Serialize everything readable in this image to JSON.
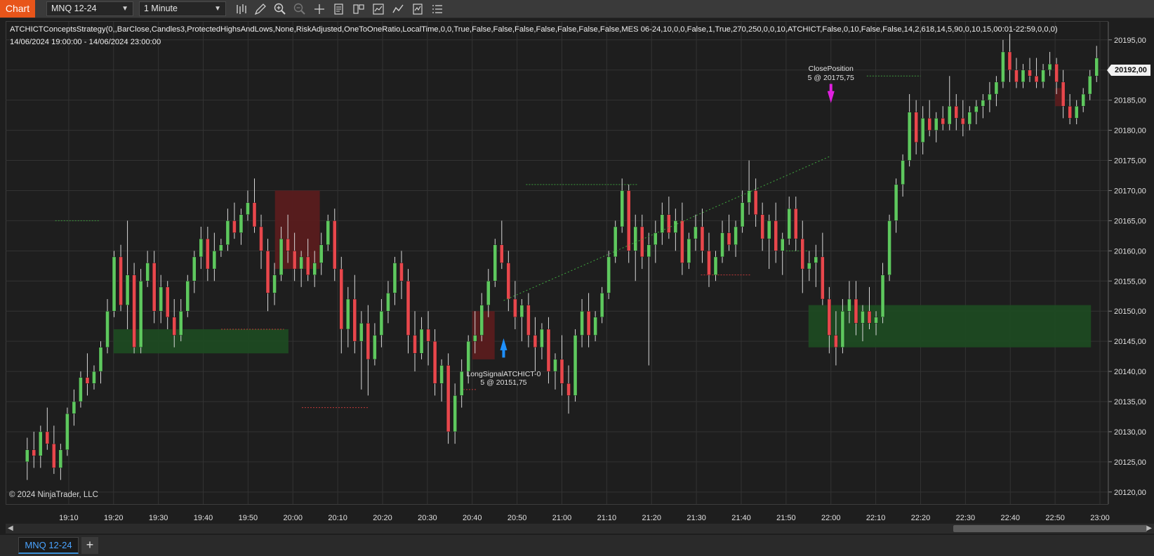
{
  "toolbar": {
    "chart_tab": "Chart",
    "instrument": "MNQ 12-24",
    "interval": "1 Minute",
    "icons": [
      "bar-type-icon",
      "draw-pencil-icon",
      "zoom-in-icon",
      "zoom-out-icon",
      "crosshair-icon",
      "properties-icon",
      "templates-icon",
      "chart-trader-icon",
      "indicators-icon",
      "strategies-icon",
      "data-box-icon"
    ]
  },
  "header": {
    "strategy_params": "ATCHICTConceptsStrategy(0,,BarClose,Candles3,ProtectedHighsAndLows,None,RiskAdjusted,OneToOneRatio,LocalTime,0,0,True,False,False,False,False,False,False,False,MES 06-24,10,0,0,False,1,True,270,250,0,0,10,ATCHICT,False,0,10,False,False,14,2,618,14,5,90,0,10,15,00:01-22:59,0,0,0)",
    "date_range": "14/06/2024 19:00:00 - 14/06/2024 23:00:00"
  },
  "copyright": "© 2024 NinjaTrader, LLC",
  "price_axis": {
    "ticks": [
      "20195,00",
      "20190,00",
      "20185,00",
      "20180,00",
      "20175,00",
      "20170,00",
      "20165,00",
      "20160,00",
      "20155,00",
      "20150,00",
      "20145,00",
      "20140,00",
      "20135,00",
      "20130,00",
      "20125,00",
      "20120,00"
    ],
    "last_price": "20192,00"
  },
  "time_axis": {
    "ticks": [
      "19:10",
      "19:20",
      "19:30",
      "19:40",
      "19:50",
      "20:00",
      "20:10",
      "20:20",
      "20:30",
      "20:40",
      "20:50",
      "21:00",
      "21:10",
      "21:20",
      "21:30",
      "21:40",
      "21:50",
      "22:00",
      "22:10",
      "22:20",
      "22:30",
      "22:40",
      "22:50",
      "23:00"
    ]
  },
  "annotations": {
    "entry_label": "LongSignalATCHICT-0",
    "entry_fill": "5 @ 20151,75",
    "exit_label": "ClosePosition",
    "exit_fill": "5 @ 20175,75"
  },
  "colors": {
    "up_candle": "#5ec85e",
    "down_candle": "#e8474c",
    "demand_zone": "#1e4a22",
    "supply_zone": "#5a1c1e",
    "entry_arrow": "#1e90ff",
    "exit_arrow": "#e020e0"
  },
  "chart_data": {
    "type": "candlestick",
    "instrument": "MNQ 12-24",
    "interval": "1 Minute",
    "x_range": [
      "19:00",
      "23:00"
    ],
    "y_range": [
      20118,
      20198
    ],
    "y_tick_step": 5,
    "grid": true,
    "last_price": 20192.0,
    "entry": {
      "label": "LongSignalATCHICT-0",
      "time": "20:47",
      "qty": 5,
      "price": 20151.75
    },
    "exit": {
      "label": "ClosePosition",
      "time": "22:00",
      "qty": 5,
      "price": 20175.75
    },
    "candles_ohlc": [
      [
        20125,
        20129,
        20122,
        20127
      ],
      [
        20127,
        20130,
        20124,
        20126
      ],
      [
        20126,
        20131,
        20124,
        20130
      ],
      [
        20130,
        20134,
        20127,
        20128
      ],
      [
        20128,
        20131,
        20123,
        20124
      ],
      [
        20124,
        20128,
        20122,
        20127
      ],
      [
        20127,
        20134,
        20126,
        20133
      ],
      [
        20133,
        20137,
        20131,
        20135
      ],
      [
        20135,
        20140,
        20134,
        20139
      ],
      [
        20139,
        20143,
        20136,
        20138
      ],
      [
        20138,
        20141,
        20137,
        20140
      ],
      [
        20140,
        20145,
        20138,
        20144
      ],
      [
        20144,
        20152,
        20143,
        20150
      ],
      [
        20150,
        20160,
        20149,
        20159
      ],
      [
        20159,
        20161,
        20150,
        20151
      ],
      [
        20151,
        20165,
        20147,
        20156
      ],
      [
        20156,
        20158,
        20143,
        20144
      ],
      [
        20144,
        20157,
        20143,
        20155
      ],
      [
        20155,
        20160,
        20154,
        20158
      ],
      [
        20158,
        20160,
        20148,
        20150
      ],
      [
        20150,
        20156,
        20148,
        20154
      ],
      [
        20154,
        20155,
        20147,
        20149
      ],
      [
        20149,
        20152,
        20144,
        20146
      ],
      [
        20146,
        20152,
        20145,
        20150
      ],
      [
        20150,
        20156,
        20149,
        20155
      ],
      [
        20155,
        20160,
        20153,
        20159
      ],
      [
        20159,
        20164,
        20157,
        20162
      ],
      [
        20162,
        20164,
        20155,
        20157
      ],
      [
        20157,
        20163,
        20155,
        20160
      ],
      [
        20160,
        20162,
        20159,
        20161
      ],
      [
        20161,
        20167,
        20160,
        20165
      ],
      [
        20165,
        20168,
        20162,
        20163
      ],
      [
        20163,
        20167,
        20161,
        20166
      ],
      [
        20166,
        20170,
        20165,
        20168
      ],
      [
        20168,
        20172,
        20163,
        20164
      ],
      [
        20164,
        20166,
        20157,
        20160
      ],
      [
        20160,
        20162,
        20150,
        20153
      ],
      [
        20153,
        20158,
        20151,
        20156
      ],
      [
        20156,
        20164,
        20155,
        20162
      ],
      [
        20162,
        20166,
        20158,
        20160
      ],
      [
        20160,
        20163,
        20155,
        20157
      ],
      [
        20157,
        20160,
        20154,
        20159
      ],
      [
        20159,
        20162,
        20155,
        20156
      ],
      [
        20156,
        20160,
        20154,
        20158
      ],
      [
        20158,
        20163,
        20156,
        20161
      ],
      [
        20161,
        20166,
        20160,
        20165
      ],
      [
        20165,
        20167,
        20155,
        20157
      ],
      [
        20157,
        20159,
        20143,
        20147
      ],
      [
        20147,
        20154,
        20144,
        20152
      ],
      [
        20152,
        20156,
        20143,
        20145
      ],
      [
        20145,
        20150,
        20137,
        20148
      ],
      [
        20148,
        20151,
        20136,
        20142
      ],
      [
        20142,
        20148,
        20141,
        20146
      ],
      [
        20146,
        20152,
        20144,
        20150
      ],
      [
        20150,
        20155,
        20148,
        20153
      ],
      [
        20153,
        20159,
        20151,
        20158
      ],
      [
        20158,
        20160,
        20152,
        20155
      ],
      [
        20155,
        20157,
        20143,
        20146
      ],
      [
        20146,
        20150,
        20140,
        20143
      ],
      [
        20143,
        20149,
        20142,
        20147
      ],
      [
        20147,
        20150,
        20141,
        20145
      ],
      [
        20145,
        20147,
        20136,
        20138
      ],
      [
        20138,
        20142,
        20135,
        20141
      ],
      [
        20141,
        20143,
        20128,
        20130
      ],
      [
        20130,
        20138,
        20128,
        20136
      ],
      [
        20136,
        20142,
        20134,
        20140
      ],
      [
        20140,
        20146,
        20138,
        20145
      ],
      [
        20145,
        20150,
        20143,
        20146
      ],
      [
        20146,
        20153,
        20145,
        20151
      ],
      [
        20151,
        20157,
        20149,
        20155
      ],
      [
        20155,
        20162,
        20154,
        20161
      ],
      [
        20161,
        20165,
        20157,
        20158
      ],
      [
        20158,
        20160,
        20150,
        20152
      ],
      [
        20152,
        20155,
        20147,
        20149
      ],
      [
        20149,
        20152,
        20145,
        20151
      ],
      [
        20151,
        20153,
        20144,
        20146
      ],
      [
        20146,
        20149,
        20140,
        20144
      ],
      [
        20144,
        20148,
        20142,
        20147
      ],
      [
        20147,
        20149,
        20138,
        20140
      ],
      [
        20140,
        20143,
        20137,
        20142
      ],
      [
        20142,
        20146,
        20136,
        20138
      ],
      [
        20138,
        20141,
        20133,
        20136
      ],
      [
        20136,
        20147,
        20135,
        20146
      ],
      [
        20146,
        20152,
        20144,
        20150
      ],
      [
        20150,
        20153,
        20144,
        20146
      ],
      [
        20146,
        20150,
        20145,
        20149
      ],
      [
        20149,
        20154,
        20148,
        20153
      ],
      [
        20153,
        20160,
        20152,
        20159
      ],
      [
        20159,
        20165,
        20158,
        20164
      ],
      [
        20164,
        20172,
        20163,
        20170
      ],
      [
        20170,
        20171,
        20158,
        20160
      ],
      [
        20160,
        20166,
        20155,
        20164
      ],
      [
        20164,
        20166,
        20157,
        20159
      ],
      [
        20159,
        20163,
        20141,
        20161
      ],
      [
        20161,
        20165,
        20158,
        20163
      ],
      [
        20163,
        20168,
        20161,
        20166
      ],
      [
        20166,
        20169,
        20162,
        20163
      ],
      [
        20163,
        20167,
        20160,
        20165
      ],
      [
        20165,
        20168,
        20156,
        20158
      ],
      [
        20158,
        20163,
        20157,
        20162
      ],
      [
        20162,
        20166,
        20160,
        20164
      ],
      [
        20164,
        20167,
        20158,
        20160
      ],
      [
        20160,
        20163,
        20154,
        20156
      ],
      [
        20156,
        20160,
        20155,
        20159
      ],
      [
        20159,
        20165,
        20158,
        20163
      ],
      [
        20163,
        20166,
        20160,
        20161
      ],
      [
        20161,
        20165,
        20159,
        20164
      ],
      [
        20164,
        20170,
        20163,
        20168
      ],
      [
        20168,
        20175,
        20166,
        20170
      ],
      [
        20170,
        20172,
        20164,
        20166
      ],
      [
        20166,
        20168,
        20160,
        20162
      ],
      [
        20162,
        20166,
        20157,
        20165
      ],
      [
        20165,
        20168,
        20158,
        20160
      ],
      [
        20160,
        20163,
        20156,
        20162
      ],
      [
        20162,
        20169,
        20161,
        20167
      ],
      [
        20167,
        20169,
        20160,
        20162
      ],
      [
        20162,
        20165,
        20153,
        20157
      ],
      [
        20157,
        20160,
        20155,
        20158
      ],
      [
        20158,
        20161,
        20154,
        20159
      ],
      [
        20159,
        20163,
        20151,
        20152
      ],
      [
        20152,
        20154,
        20143,
        20146
      ],
      [
        20146,
        20150,
        20141,
        20144
      ],
      [
        20144,
        20152,
        20143,
        20150
      ],
      [
        20150,
        20155,
        20148,
        20152
      ],
      [
        20152,
        20155,
        20146,
        20148
      ],
      [
        20148,
        20151,
        20145,
        20150
      ],
      [
        20150,
        20154,
        20147,
        20148
      ],
      [
        20148,
        20150,
        20146,
        20149
      ],
      [
        20149,
        20158,
        20148,
        20156
      ],
      [
        20156,
        20166,
        20155,
        20165
      ],
      [
        20165,
        20172,
        20163,
        20171
      ],
      [
        20171,
        20176,
        20169,
        20175
      ],
      [
        20175,
        20186,
        20174,
        20183
      ],
      [
        20183,
        20185,
        20176,
        20178
      ],
      [
        20178,
        20184,
        20176,
        20182
      ],
      [
        20182,
        20185,
        20179,
        20180
      ],
      [
        20180,
        20183,
        20178,
        20182
      ],
      [
        20182,
        20184,
        20180,
        20181
      ],
      [
        20181,
        20189,
        20180,
        20184
      ],
      [
        20184,
        20186,
        20180,
        20182
      ],
      [
        20182,
        20185,
        20179,
        20181
      ],
      [
        20181,
        20184,
        20180,
        20183
      ],
      [
        20183,
        20185,
        20181,
        20184
      ],
      [
        20184,
        20186,
        20182,
        20185
      ],
      [
        20185,
        20188,
        20183,
        20186
      ],
      [
        20186,
        20189,
        20184,
        20188
      ],
      [
        20188,
        20195,
        20187,
        20193
      ],
      [
        20193,
        20196,
        20188,
        20190
      ],
      [
        20190,
        20192,
        20187,
        20188
      ],
      [
        20188,
        20191,
        20187,
        20190
      ],
      [
        20190,
        20192,
        20188,
        20189
      ],
      [
        20189,
        20192,
        20187,
        20188
      ],
      [
        20188,
        20191,
        20187,
        20190
      ],
      [
        20190,
        20193,
        20189,
        20191
      ],
      [
        20191,
        20192,
        20186,
        20188
      ],
      [
        20188,
        20190,
        20182,
        20184
      ],
      [
        20184,
        20186,
        20181,
        20182
      ],
      [
        20182,
        20185,
        20181,
        20184
      ],
      [
        20184,
        20187,
        20183,
        20186
      ],
      [
        20186,
        20190,
        20185,
        20189
      ],
      [
        20189,
        20194,
        20188,
        20192
      ]
    ],
    "zones": [
      {
        "type": "demand",
        "time_start": "19:20",
        "time_end": "19:59",
        "low": 20143,
        "high": 20147
      },
      {
        "type": "supply",
        "time_start": "19:56",
        "time_end": "20:06",
        "low": 20157,
        "high": 20170
      },
      {
        "type": "supply",
        "time_start": "20:40",
        "time_end": "20:45",
        "low": 20142,
        "high": 20150
      },
      {
        "type": "demand",
        "time_start": "21:55",
        "time_end": "22:58",
        "low": 20144,
        "high": 20151
      },
      {
        "type": "supply",
        "time_start": "22:50",
        "time_end": "22:52",
        "low": 20184,
        "high": 20187
      }
    ],
    "levels": [
      {
        "type": "high",
        "time_start": "19:07",
        "time_end": "19:17",
        "price": 20165
      },
      {
        "type": "low",
        "time_start": "19:44",
        "time_end": "19:58",
        "price": 20147
      },
      {
        "type": "low",
        "time_start": "20:02",
        "time_end": "20:17",
        "price": 20134
      },
      {
        "type": "low",
        "time_start": "20:38",
        "time_end": "20:41",
        "price": 20137
      },
      {
        "type": "high",
        "time_start": "20:52",
        "time_end": "21:17",
        "price": 20171
      },
      {
        "type": "low",
        "time_start": "21:31",
        "time_end": "21:42",
        "price": 20156
      },
      {
        "type": "high",
        "time_start": "21:50",
        "time_end": "21:55",
        "price": 20160
      },
      {
        "type": "high",
        "time_start": "22:08",
        "time_end": "22:20",
        "price": 20189
      }
    ]
  }
}
